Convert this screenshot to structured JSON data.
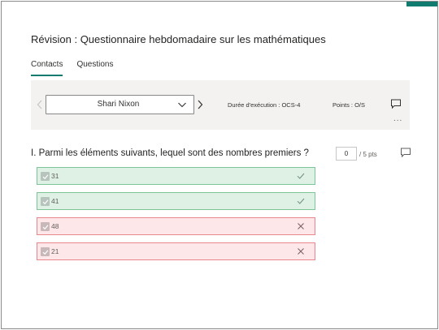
{
  "form": {
    "title": "Révision : Questionnaire hebdomadaire sur les mathématiques",
    "accent_color": "#107c6f"
  },
  "tabs": [
    {
      "label": "Contacts",
      "active": true
    },
    {
      "label": "Questions",
      "active": false
    }
  ],
  "toolbar": {
    "prev_icon": "chevron-left-icon",
    "next_icon": "chevron-right-icon",
    "respondent": "Shari Nixon",
    "duration": "Durée d'exécution : OCS-4",
    "points": "Points : O/S",
    "more_label": "..."
  },
  "question": {
    "text": "I. Parmi les éléments suivants, lequel sont des nombres premiers ?",
    "score_value": "0",
    "points_label": "/ 5 pts",
    "answers": [
      {
        "label": "31",
        "status": "correct",
        "checked": true
      },
      {
        "label": "41",
        "status": "correct",
        "checked": true
      },
      {
        "label": "48",
        "status": "wrong",
        "checked": true
      },
      {
        "label": "21",
        "status": "wrong",
        "checked": true
      }
    ]
  },
  "colors": {
    "correct_bg": "#dff0e5",
    "correct_border": "#7cc49a",
    "wrong_bg": "#fde7e9",
    "wrong_border": "#e8858d"
  }
}
